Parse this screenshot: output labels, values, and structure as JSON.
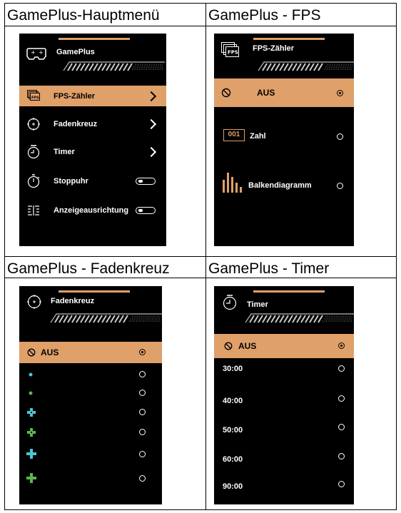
{
  "cells": [
    {
      "title": "GamePlus-Hauptmenü"
    },
    {
      "title": "GamePlus - FPS"
    },
    {
      "title": "GamePlus - Fadenkreuz"
    },
    {
      "title": "GamePlus - Timer"
    }
  ],
  "main_menu": {
    "header": "GamePlus",
    "items": [
      {
        "label": "FPS-Zähler",
        "icon": "fps-icon",
        "control": "chevron"
      },
      {
        "label": "Fadenkreuz",
        "icon": "crosshair-icon",
        "control": "chevron"
      },
      {
        "label": "Timer",
        "icon": "timer-icon",
        "control": "chevron"
      },
      {
        "label": "Stoppuhr",
        "icon": "stopwatch-icon",
        "control": "toggle"
      },
      {
        "label": "Anzeigeausrichtung",
        "icon": "display-align-icon",
        "control": "toggle"
      }
    ],
    "selected_index": 0
  },
  "fps_menu": {
    "header": "FPS-Zähler",
    "fps_icon_text": "FPS",
    "items": [
      {
        "label": "AUS",
        "icon": "off-icon"
      },
      {
        "label": "Zahl",
        "icon": "number-icon",
        "icon_text": "001"
      },
      {
        "label": "Balkendiagramm",
        "icon": "bar-graph-icon"
      }
    ],
    "selected_index": 0
  },
  "crosshair_menu": {
    "header": "Fadenkreuz",
    "off_label": "AUS",
    "options": [
      {
        "icon": "dot-cyan-icon",
        "color": "#4fc3d8"
      },
      {
        "icon": "dot-green-icon",
        "color": "#58b84a"
      },
      {
        "icon": "crosshair-small-cyan-icon",
        "color": "#4fc3d8"
      },
      {
        "icon": "crosshair-small-green-icon",
        "color": "#58b84a"
      },
      {
        "icon": "cross-cyan-icon",
        "color": "#4fc3d8"
      },
      {
        "icon": "cross-green-icon",
        "color": "#58b84a"
      }
    ],
    "selected_index": 0
  },
  "timer_menu": {
    "header": "Timer",
    "items": [
      {
        "label": "AUS"
      },
      {
        "label": "30:00"
      },
      {
        "label": "40:00"
      },
      {
        "label": "50:00"
      },
      {
        "label": "60:00"
      },
      {
        "label": "90:00"
      }
    ],
    "selected_index": 0
  },
  "colors": {
    "accent": "#e0a06a",
    "panel": "#000000",
    "stripe": "#c8c8c8"
  }
}
